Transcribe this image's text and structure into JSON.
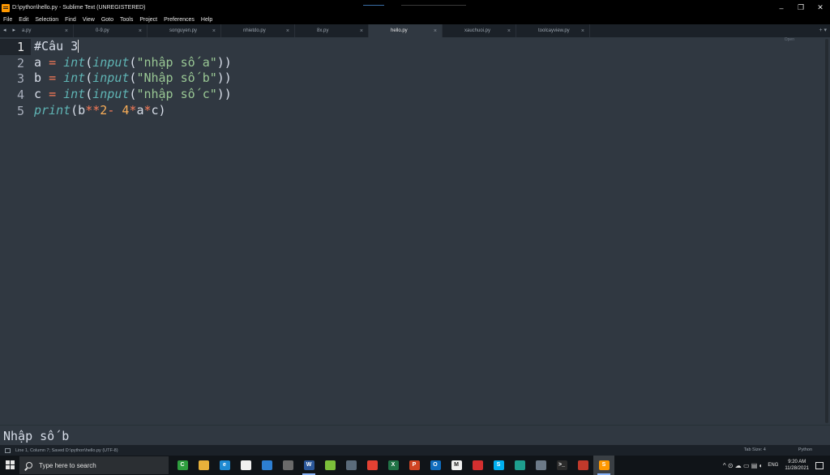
{
  "window": {
    "title": "D:\\python\\hello.py - Sublime Text (UNREGISTERED)",
    "controls": {
      "minimize": "–",
      "maximize": "❐",
      "close": "✕"
    }
  },
  "menu": [
    "File",
    "Edit",
    "Selection",
    "Find",
    "View",
    "Goto",
    "Tools",
    "Project",
    "Preferences",
    "Help"
  ],
  "tabs": [
    {
      "label": "a.py",
      "active": false
    },
    {
      "label": "0-9.py",
      "active": false
    },
    {
      "label": "songuyen.py",
      "active": false
    },
    {
      "label": "nhietdo.py",
      "active": false
    },
    {
      "label": "8x.py",
      "active": false
    },
    {
      "label": "hello.py",
      "active": true
    },
    {
      "label": "xauchuoi.py",
      "active": false
    },
    {
      "label": "toolcayview.py",
      "active": false
    }
  ],
  "tab_nav": "◂ ▸",
  "tab_right": "+ ▾",
  "tab_close_glyph": "×",
  "editor": {
    "line_numbers": [
      "1",
      "2",
      "3",
      "4",
      "5"
    ],
    "current_line": 1,
    "minimap_label": "Open",
    "code_lines": [
      [
        {
          "t": "#Câu 3",
          "c": "plain"
        }
      ],
      [
        {
          "t": "a ",
          "c": "plain"
        },
        {
          "t": "=",
          "c": "op"
        },
        {
          "t": " ",
          "c": "plain"
        },
        {
          "t": "int",
          "c": "fn"
        },
        {
          "t": "(",
          "c": "plain"
        },
        {
          "t": "input",
          "c": "fn"
        },
        {
          "t": "(",
          "c": "plain"
        },
        {
          "t": "\"nhập số a\"",
          "c": "str"
        },
        {
          "t": "))",
          "c": "plain"
        }
      ],
      [
        {
          "t": "b ",
          "c": "plain"
        },
        {
          "t": "=",
          "c": "op"
        },
        {
          "t": " ",
          "c": "plain"
        },
        {
          "t": "int",
          "c": "fn"
        },
        {
          "t": "(",
          "c": "plain"
        },
        {
          "t": "input",
          "c": "fn"
        },
        {
          "t": "(",
          "c": "plain"
        },
        {
          "t": "\"Nhập số b\"",
          "c": "str"
        },
        {
          "t": "))",
          "c": "plain"
        }
      ],
      [
        {
          "t": "c ",
          "c": "plain"
        },
        {
          "t": "=",
          "c": "op"
        },
        {
          "t": " ",
          "c": "plain"
        },
        {
          "t": "int",
          "c": "fn"
        },
        {
          "t": "(",
          "c": "plain"
        },
        {
          "t": "input",
          "c": "fn"
        },
        {
          "t": "(",
          "c": "plain"
        },
        {
          "t": "\"nhập số c\"",
          "c": "str"
        },
        {
          "t": "))",
          "c": "plain"
        }
      ],
      [
        {
          "t": "print",
          "c": "fn"
        },
        {
          "t": "(b",
          "c": "plain"
        },
        {
          "t": "**",
          "c": "op"
        },
        {
          "t": "2",
          "c": "num"
        },
        {
          "t": "- ",
          "c": "op"
        },
        {
          "t": "4",
          "c": "num"
        },
        {
          "t": "*",
          "c": "op"
        },
        {
          "t": "a",
          "c": "plain"
        },
        {
          "t": "*",
          "c": "op"
        },
        {
          "t": "c)",
          "c": "plain"
        }
      ]
    ]
  },
  "output_panel": {
    "text": "Nhập số b"
  },
  "status": {
    "left": "Line 1, Column 7; Saved D:\\python\\hello.py (UTF-8)",
    "tab_size": "Tab Size: 4",
    "syntax": "Python"
  },
  "taskbar": {
    "search_placeholder": "Type here to search",
    "apps": [
      {
        "name": "camtasia",
        "color": "#2e9e3e",
        "glyph": "C",
        "running": false
      },
      {
        "name": "file-explorer",
        "color": "#e8b13a",
        "glyph": "",
        "running": false
      },
      {
        "name": "edge",
        "color": "#1f8ad2",
        "glyph": "e",
        "running": false
      },
      {
        "name": "store",
        "color": "#f0f0f0",
        "glyph": "",
        "running": false
      },
      {
        "name": "mail",
        "color": "#2d7fd2",
        "glyph": "",
        "running": false
      },
      {
        "name": "photos",
        "color": "#6a6a6a",
        "glyph": "",
        "running": false
      },
      {
        "name": "word",
        "color": "#2b579a",
        "glyph": "W",
        "running": true
      },
      {
        "name": "app-green",
        "color": "#7bbf3a",
        "glyph": "",
        "running": false
      },
      {
        "name": "picture-viewer",
        "color": "#5b6b7a",
        "glyph": "",
        "running": false
      },
      {
        "name": "chrome",
        "color": "#e34133",
        "glyph": "",
        "running": false
      },
      {
        "name": "excel",
        "color": "#217346",
        "glyph": "X",
        "running": false
      },
      {
        "name": "powerpoint",
        "color": "#d04423",
        "glyph": "P",
        "running": false
      },
      {
        "name": "outlook",
        "color": "#0f6cbd",
        "glyph": "O",
        "running": false
      },
      {
        "name": "medium",
        "color": "#f0f0f0",
        "glyph": "M",
        "running": false
      },
      {
        "name": "recorder",
        "color": "#d32f2f",
        "glyph": "",
        "running": false
      },
      {
        "name": "skype",
        "color": "#00aff0",
        "glyph": "S",
        "running": false
      },
      {
        "name": "app-teal",
        "color": "#1e9e8e",
        "glyph": "",
        "running": false
      },
      {
        "name": "photo-editor",
        "color": "#6c7a88",
        "glyph": "",
        "running": false
      },
      {
        "name": "terminal",
        "color": "#2b2b2b",
        "glyph": ">_",
        "running": false
      },
      {
        "name": "app-red",
        "color": "#c0392b",
        "glyph": "",
        "running": false
      },
      {
        "name": "sublime-text",
        "color": "#ff9800",
        "glyph": "S",
        "running": true,
        "current": true
      }
    ],
    "tray_lang": "ENG",
    "tray_glyphs": "^ ⊙ ☁ ▭ ▤ ◐",
    "time": "9:20 AM",
    "date": "11/28/2021"
  }
}
